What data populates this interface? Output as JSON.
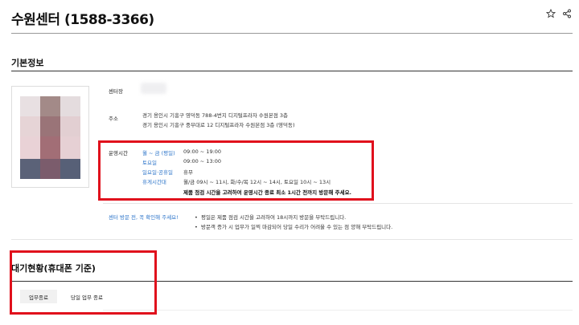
{
  "header": {
    "title": "수원센터 (1588-3366)",
    "star_icon": "star-outline-icon",
    "share_icon": "share-icon"
  },
  "basic_info": {
    "section_title": "기본정보",
    "manager_label": "센터장",
    "address_label": "주소",
    "address_lines": [
      "경기 용인시 기흥구 영덕동 788-4번지 디지털프라자 수원본점 3층",
      "경기 용인시 기흥구 중부대로 12 디지털프라자 수원본점 3층 (영덕동)"
    ],
    "hours_label": "운영시간",
    "hours": [
      {
        "key": "월 ~ 금 (평일)",
        "value": "09:00 ~ 19:00"
      },
      {
        "key": "토요일",
        "value": "09:00 ~ 13:00"
      },
      {
        "key": "일요일·공휴일",
        "value": "휴무"
      },
      {
        "key": "휴게시간대",
        "value": "월/금 09시 ~ 11시, 화/수/목 12시 ~ 14시, 토요일 10시 ~ 13시"
      }
    ],
    "hours_note": "제품 점검 시간을 고려하여 운영시간 종료 최소 1시간 전까지 방문해 주세요.",
    "notice_label": "센터 방문 전, 꼭 확인해 주세요!",
    "notices": [
      "평일은 제품 점검 시간을 고려하여 18시까지 방문을 부탁드립니다.",
      "방문객 증가 시 업무가 일찍 마감되어 당일 수리가 어려울 수 있는 점 양해 부탁드립니다."
    ]
  },
  "waiting": {
    "section_title": "대기현황(휴대폰 기준)",
    "status_tag": "업무종료",
    "status_text": "당일 업무 종료"
  },
  "colors": {
    "highlight_box": "#e0101c",
    "link_blue": "#2a73c9"
  }
}
